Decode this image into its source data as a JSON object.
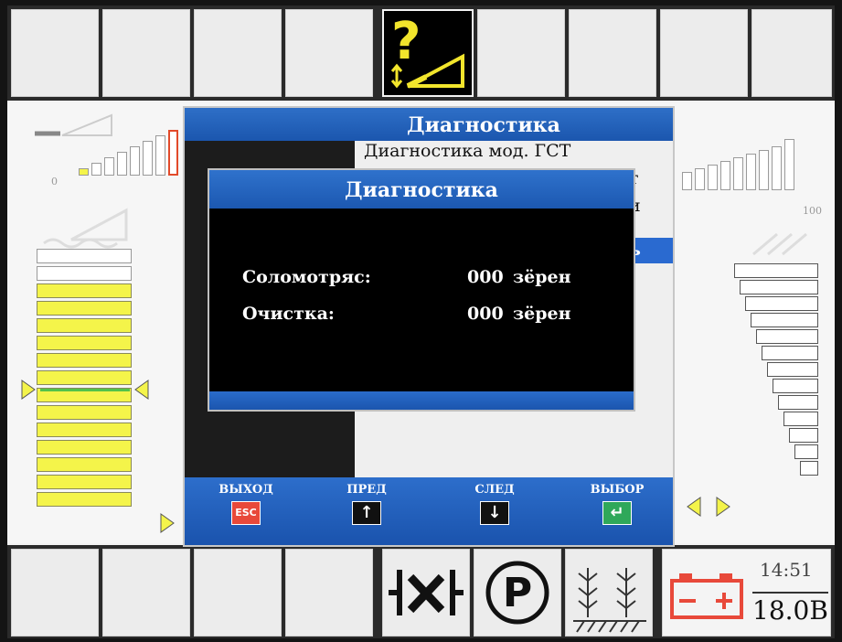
{
  "outer_dialog": {
    "title": "Диагностика",
    "menu_items": [
      "Диагностика мод. ГСТ",
      "т",
      "и",
      "ь"
    ],
    "footer": [
      {
        "label": "ВЫХОД",
        "key": "ESC",
        "key_color": "#e8493a"
      },
      {
        "label": "ПРЕД",
        "key": "↑",
        "key_color": "#111111"
      },
      {
        "label": "СЛЕД",
        "key": "↓",
        "key_color": "#111111"
      },
      {
        "label": "ВЫБОР",
        "key": "↵",
        "key_color": "#2fa85a"
      }
    ]
  },
  "inner_dialog": {
    "title": "Диагностика",
    "rows": [
      {
        "label": "Соломотряс:",
        "value": "000",
        "unit": "зёрен"
      },
      {
        "label": "Очистка:",
        "value": "000",
        "unit": "зёрен"
      }
    ]
  },
  "gauges": {
    "left_scale_min": "0",
    "right_scale_max": "100"
  },
  "status": {
    "time": "14:51",
    "voltage": "18.0В"
  },
  "colors": {
    "accent_blue": "#1f5fbf",
    "warning_yellow": "#f4f44a",
    "battery_red": "#e8493a"
  },
  "icons": {
    "top_center": "header-lift-warning-icon",
    "bottom": [
      "differential-lock-icon",
      "parking-brake-icon",
      "crop-row-icon",
      "battery-icon"
    ]
  }
}
